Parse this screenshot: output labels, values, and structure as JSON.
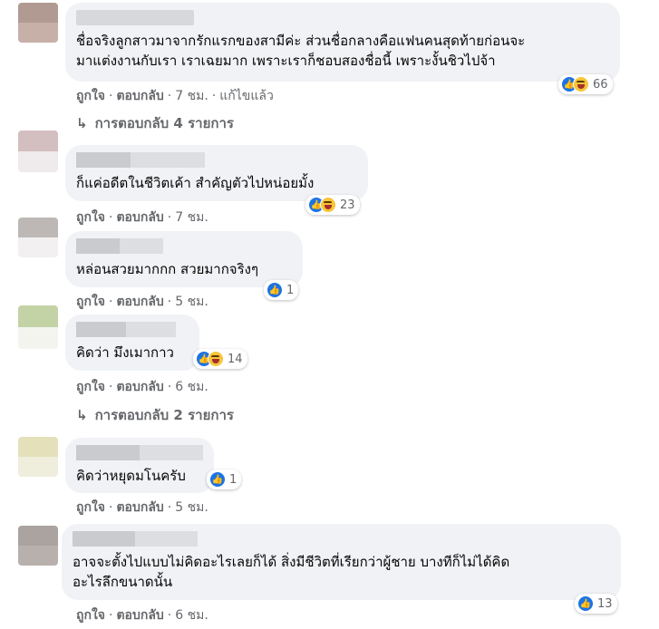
{
  "colors": {
    "bubble": "#f0f2f5",
    "meta_text": "#65676b",
    "like_blue": "#1b74e4",
    "haha_yellow": "#f7c53b"
  },
  "comments": [
    {
      "text_lines": [
        "ชื่อจริงลูกสาวมาจากรักแรกของสามีค่ะ ส่วนชื่อกลางคือแฟนคนสุดท้ายก่อนจะ",
        "มาแต่งงานกับเรา เราเฉยมาก เพราะเราก็ชอบสองชื่อนี้ เพราะงั้นชิวไปจ้า"
      ],
      "reaction_count": "66",
      "reactions": [
        "like-icon",
        "haha-icon"
      ],
      "like": "ถูกใจ",
      "reply": "ตอบกลับ",
      "time": "7 ชม.",
      "edited": "แก้ไขแล้ว",
      "replies": "การตอบกลับ 4 รายการ"
    },
    {
      "text_lines": [
        "ก็แค่อดีตในชีวิตเค้า สำคัญตัวไปหน่อยมั้ง"
      ],
      "reaction_count": "23",
      "reactions": [
        "like-icon",
        "haha-icon"
      ],
      "like": "ถูกใจ",
      "reply": "ตอบกลับ",
      "time": "7 ชม."
    },
    {
      "text_lines": [
        "หล่อนสวยมากกก สวยมากจริงๆ"
      ],
      "reaction_count": "1",
      "reactions": [
        "like-icon"
      ],
      "like": "ถูกใจ",
      "reply": "ตอบกลับ",
      "time": "5 ชม."
    },
    {
      "text_lines": [
        "คิดว่า มึงเมากาว"
      ],
      "reaction_count": "14",
      "reactions": [
        "like-icon",
        "haha-icon"
      ],
      "like": "ถูกใจ",
      "reply": "ตอบกลับ",
      "time": "6 ชม.",
      "replies": "การตอบกลับ 2 รายการ"
    },
    {
      "text_lines": [
        "คิดว่าหยุดมโนครับ"
      ],
      "reaction_count": "1",
      "reactions": [
        "like-icon"
      ],
      "like": "ถูกใจ",
      "reply": "ตอบกลับ",
      "time": "5 ชม."
    },
    {
      "text_lines": [
        "อาจจะตั้งไปแบบไม่คิดอะไรเลยก็ได้ สิ่งมีชีวิตที่เรียกว่าผู้ชาย บางทีก็ไม่ได้คิด",
        "อะไรลึกขนาดนั้น"
      ],
      "reaction_count": "13",
      "reactions": [
        "like-icon"
      ],
      "like": "ถูกใจ",
      "reply": "ตอบกลับ",
      "time": "6 ชม."
    }
  ]
}
